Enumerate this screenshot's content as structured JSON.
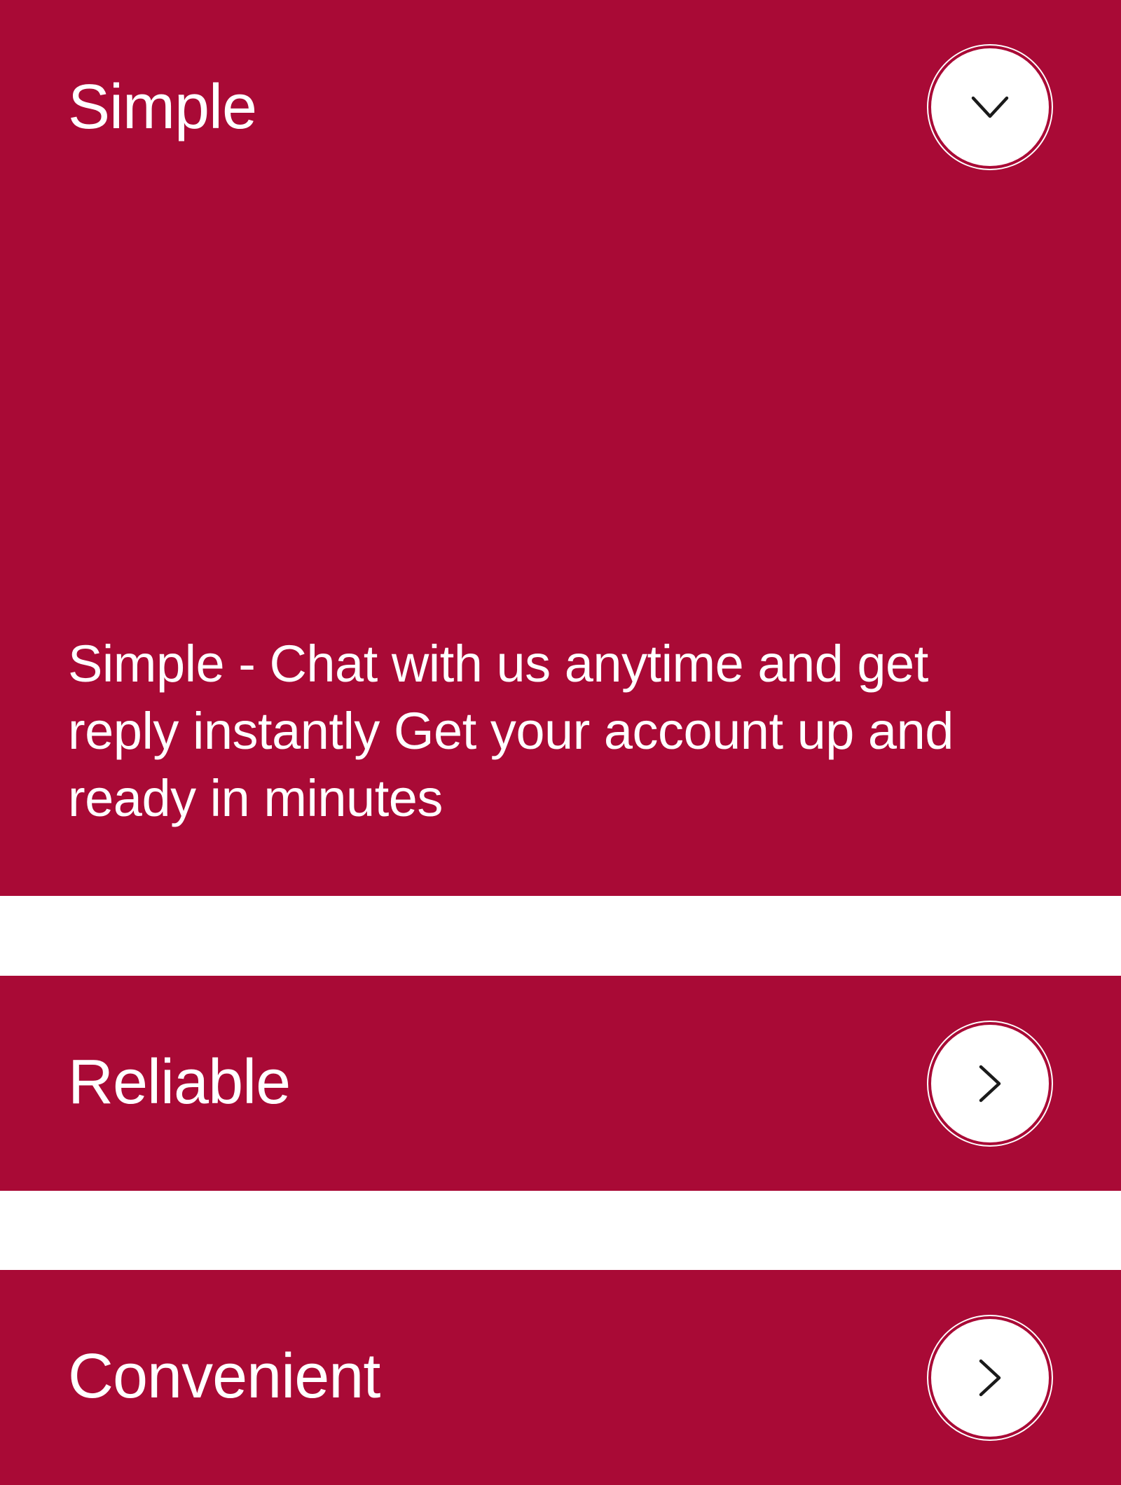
{
  "accordion": {
    "items": [
      {
        "title": "Simple",
        "expanded": true,
        "toggle_icon": "chevron-down-icon",
        "body": "Simple - Chat with us anytime and get reply instantly Get your account up and ready in minutes"
      },
      {
        "title": "Reliable",
        "expanded": false,
        "toggle_icon": "chevron-right-icon"
      },
      {
        "title": "Convenient",
        "expanded": false,
        "toggle_icon": "chevron-right-icon"
      }
    ]
  },
  "colors": {
    "panel_background": "#a90a36",
    "page_background": "#ffffff",
    "text": "#ffffff",
    "icon_stroke": "#1a1a1a"
  }
}
